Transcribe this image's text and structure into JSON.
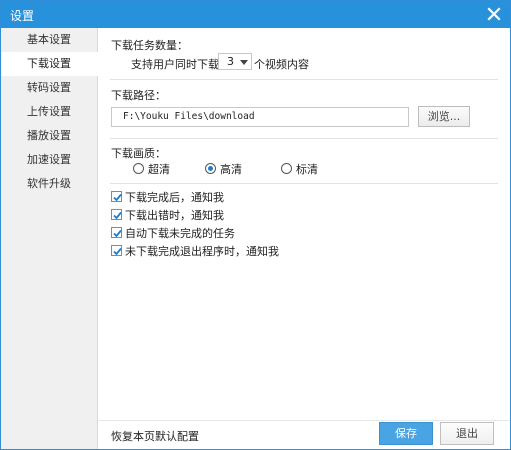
{
  "window": {
    "title": "设置"
  },
  "sidebar": {
    "items": [
      {
        "label": "基本设置"
      },
      {
        "label": "下载设置",
        "active": true
      },
      {
        "label": "转码设置"
      },
      {
        "label": "上传设置"
      },
      {
        "label": "播放设置"
      },
      {
        "label": "加速设置"
      },
      {
        "label": "软件升级"
      }
    ]
  },
  "download_count": {
    "label": "下载任务数量：",
    "prefix": "支持用户同时下载",
    "value": "3",
    "suffix": "个视频内容"
  },
  "download_path": {
    "label": "下载路径：",
    "value": "F:\\Youku Files\\download",
    "browse_label": "浏览..."
  },
  "quality": {
    "label": "下载画质：",
    "options": [
      {
        "label": "超清",
        "checked": false
      },
      {
        "label": "高清",
        "checked": true
      },
      {
        "label": "标清",
        "checked": false
      }
    ]
  },
  "notifications": [
    {
      "label": "下载完成后，通知我",
      "checked": true
    },
    {
      "label": "下载出错时，通知我",
      "checked": true
    },
    {
      "label": "自动下载未完成的任务",
      "checked": true
    },
    {
      "label": "未下载完成退出程序时，通知我",
      "checked": true
    }
  ],
  "footer": {
    "restore_label": "恢复本页默认配置",
    "save_label": "保存",
    "exit_label": "退出"
  },
  "colors": {
    "titlebar": "#2891dc",
    "primary_button": "#48a4e3",
    "checkbox": "#1f7ccc"
  }
}
